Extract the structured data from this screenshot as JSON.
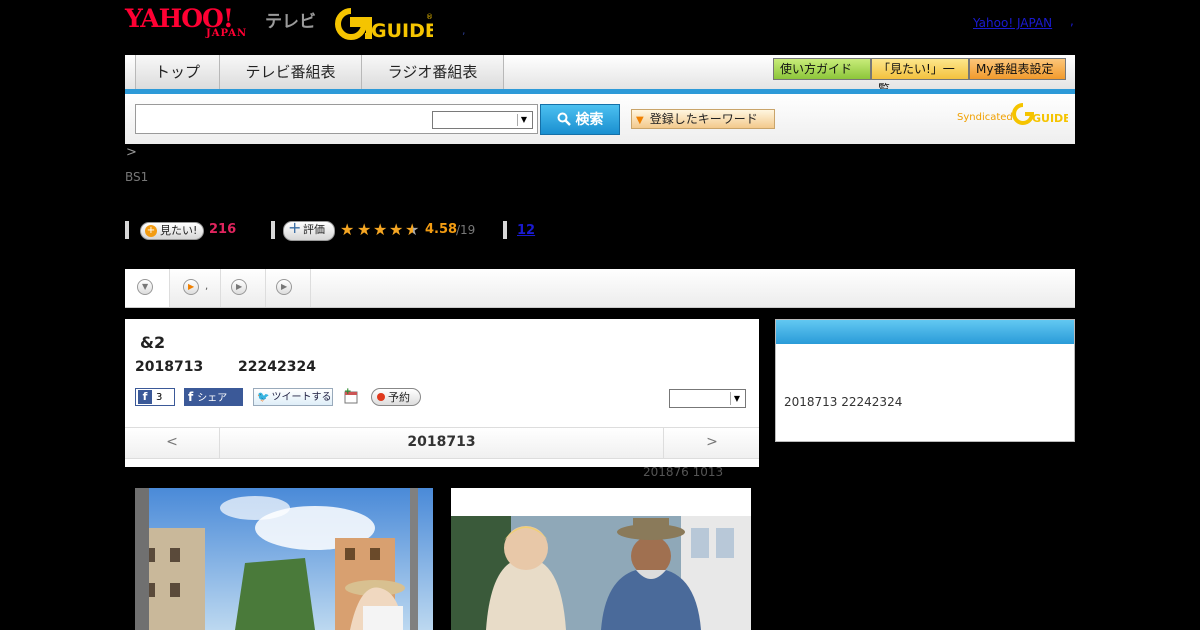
{
  "header": {
    "logo_yahoo": "YAHOO!",
    "logo_japan": "JAPAN",
    "logo_tv": "テレビ",
    "logo_gguide": "GUIDE",
    "dot": ",",
    "yahoo_japan_link": "Yahoo! JAPAN",
    "yahoo_japan_dot": ","
  },
  "nav": {
    "tabs": [
      {
        "label": "トップ"
      },
      {
        "label": "テレビ番組表"
      },
      {
        "label": "ラジオ番組表"
      }
    ],
    "buttons": [
      {
        "label": "使い方ガイド",
        "color": "#9bd241"
      },
      {
        "label": "「見たい!」一覧",
        "color": "#f6c94a"
      },
      {
        "label": "My番組表設定",
        "color": "#f5a33a"
      }
    ]
  },
  "search": {
    "value": "",
    "select_value": "",
    "button_label": "検索",
    "keyword_button_label": "登録したキーワード",
    "syndicated_label": "Syndicated",
    "syndicated_logo": "GUIDE"
  },
  "breadcrumb": ">",
  "channel": "BS1",
  "stats": {
    "mitai_label": "見たい!",
    "mitai_count": "216",
    "rating_label": "評価",
    "rating_value": "4.58",
    "rating_count": "/19",
    "stars": 4.5,
    "review_link": "12"
  },
  "tabs_row": {
    "tab2_suffix": ","
  },
  "program": {
    "title": "&2",
    "date": "2018713",
    "time": "22242324",
    "fb_count": "3",
    "fb_share": "シェア",
    "tweet": "ツイートする",
    "reserve": "予約",
    "select_value": "",
    "nav_prev": "<",
    "nav_date": "2018713",
    "nav_next": ">"
  },
  "update_note": "201876  1013",
  "right_panel": {
    "text": "2018713  22242324"
  },
  "colors": {
    "accent_blue": "#2d9ad8",
    "pink": "#e0245e",
    "orange": "#f08000",
    "star": "#f5a623"
  }
}
